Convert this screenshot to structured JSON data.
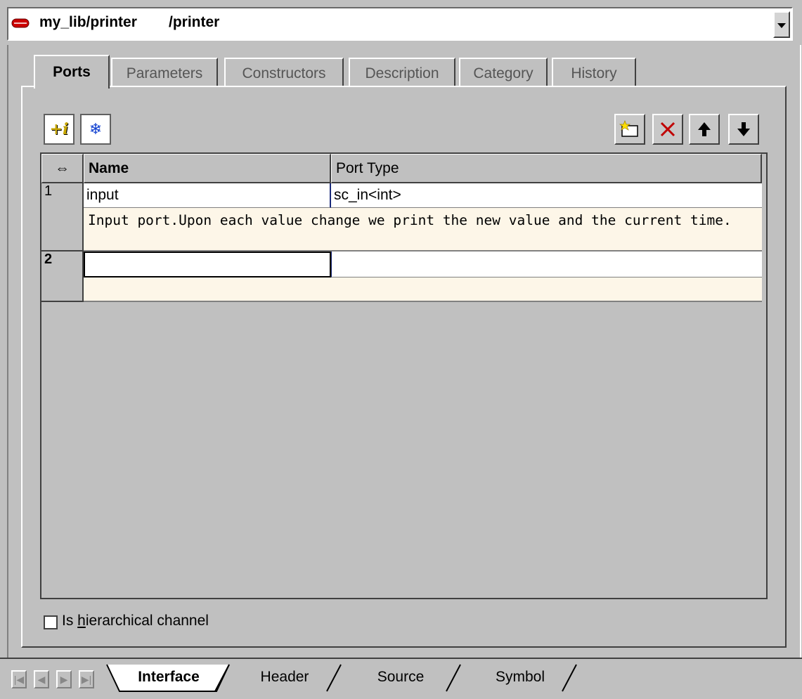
{
  "title": {
    "library_path": "my_lib/printer",
    "object_path": "/printer",
    "icon": "red-capsule-icon",
    "dropdown_icon": "chevron-down-icon"
  },
  "tabs": [
    {
      "label": "Ports",
      "active": true
    },
    {
      "label": "Parameters",
      "active": false
    },
    {
      "label": "Constructors",
      "active": false
    },
    {
      "label": "Description",
      "active": false
    },
    {
      "label": "Category",
      "active": false
    },
    {
      "label": "History",
      "active": false
    }
  ],
  "toolbar_left": [
    {
      "icon": "add-info-icon",
      "glyph": "+i"
    },
    {
      "icon": "snowflake-icon",
      "glyph": "❄"
    }
  ],
  "toolbar_right": [
    {
      "icon": "new-row-icon"
    },
    {
      "icon": "delete-icon"
    },
    {
      "icon": "move-up-icon"
    },
    {
      "icon": "move-down-icon"
    }
  ],
  "table": {
    "resize_glyph": "⇔",
    "columns": [
      "Name",
      "Port Type"
    ],
    "rows": [
      {
        "index": "1",
        "name": "input",
        "port_type": "sc_in<int>",
        "description": "Input port.Upon each value change we print the new value and the current time."
      },
      {
        "index": "2",
        "name": "",
        "port_type": "",
        "description": ""
      }
    ]
  },
  "checkbox": {
    "label_prefix": "Is ",
    "label_mnemonic": "h",
    "label_suffix": "ierarchical channel",
    "checked": false
  },
  "bottom_tabs": [
    {
      "label": "Interface",
      "active": true
    },
    {
      "label": "Header",
      "active": false
    },
    {
      "label": "Source",
      "active": false
    },
    {
      "label": "Symbol",
      "active": false
    }
  ],
  "nav_buttons": [
    "first-icon",
    "prev-icon",
    "next-icon",
    "last-icon"
  ],
  "colors": {
    "accent_red": "#cc0000",
    "description_bg": "#fdf6e8",
    "panel_bg": "#c0c0c0"
  }
}
